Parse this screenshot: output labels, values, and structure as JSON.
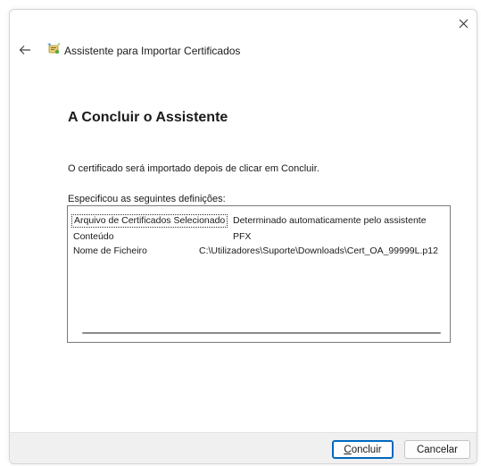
{
  "wizard": {
    "title": "Assistente para Importar Certificados"
  },
  "content": {
    "heading": "A Concluir o Assistente",
    "description": "O certificado será importado depois de clicar em Concluir.",
    "list_label": "Especificou as seguintes definições:",
    "rows": [
      {
        "name": "Arquivo de Certificados Selecionado",
        "value": "Determinado automaticamente pelo assistente"
      },
      {
        "name": "Conteúdo",
        "value": "PFX"
      },
      {
        "name": "Nome de Ficheiro",
        "value": "C:\\Utilizadores\\Suporte\\Downloads\\Cert_OA_99999L.p12"
      }
    ]
  },
  "buttons": {
    "finish_accel": "C",
    "finish_rest": "oncluir",
    "cancel": "Cancelar"
  },
  "icons": {
    "close": "close-icon",
    "back": "back-arrow-icon",
    "wizard": "certificate-wizard-icon"
  },
  "colors": {
    "accent": "#0067c0",
    "footer_bg": "#f0f0f0",
    "border": "#7a7a7a"
  }
}
